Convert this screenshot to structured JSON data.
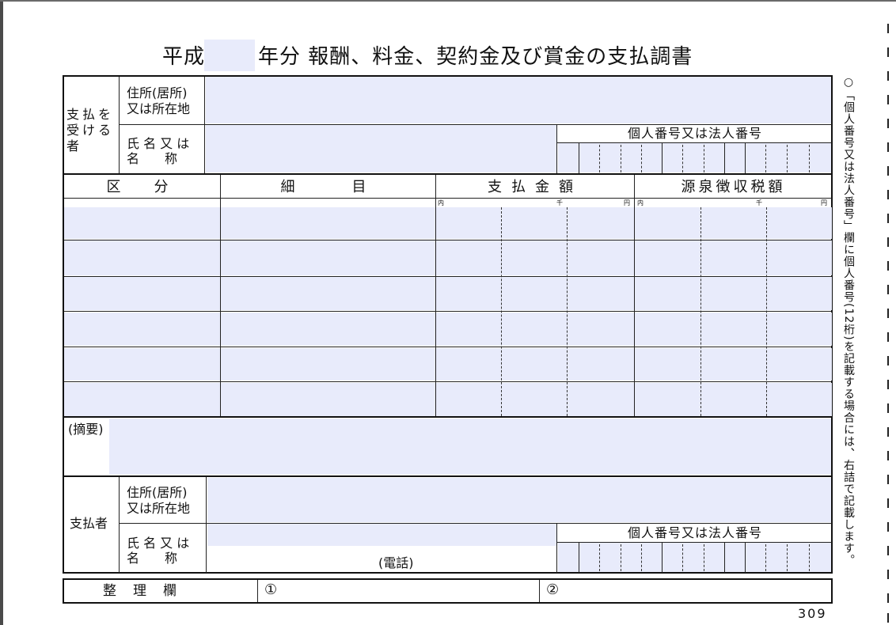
{
  "title": {
    "era": "平成",
    "rest": "年分 報酬、料金、契約金及び賞金の支払調書"
  },
  "recipient": {
    "section_label": "支払を受ける者",
    "address_label_1": "住所(居所)",
    "address_label_2": "又は所在地",
    "name_label_1": "氏 名 又 は",
    "name_label_2": "名　　称",
    "number_label": "個人番号又は法人番号"
  },
  "table": {
    "headers": [
      "区　分",
      "細　　目",
      "支払金額",
      "源泉徴収税額"
    ],
    "unit_labels": {
      "oku": "内",
      "sen": "千",
      "en": "円"
    },
    "row_count": 6
  },
  "memo_label": "(摘要)",
  "payer": {
    "section_label": "支払者",
    "address_label_1": "住所(居所)",
    "address_label_2": "又は所在地",
    "name_label_1": "氏 名 又 は",
    "name_label_2": "名　　称",
    "phone_label": "(電話)",
    "number_label": "個人番号又は法人番号"
  },
  "seiri": {
    "label": "整　理　欄",
    "slot1": "①",
    "slot2": "②"
  },
  "form_code": "309",
  "side_note": "○「個人番号又は法人番号」欄に個人番号(12桁)を記載する場合には、右詰で記載します。",
  "colors": {
    "input_fill": "#e8ebfb",
    "line": "#111111"
  }
}
